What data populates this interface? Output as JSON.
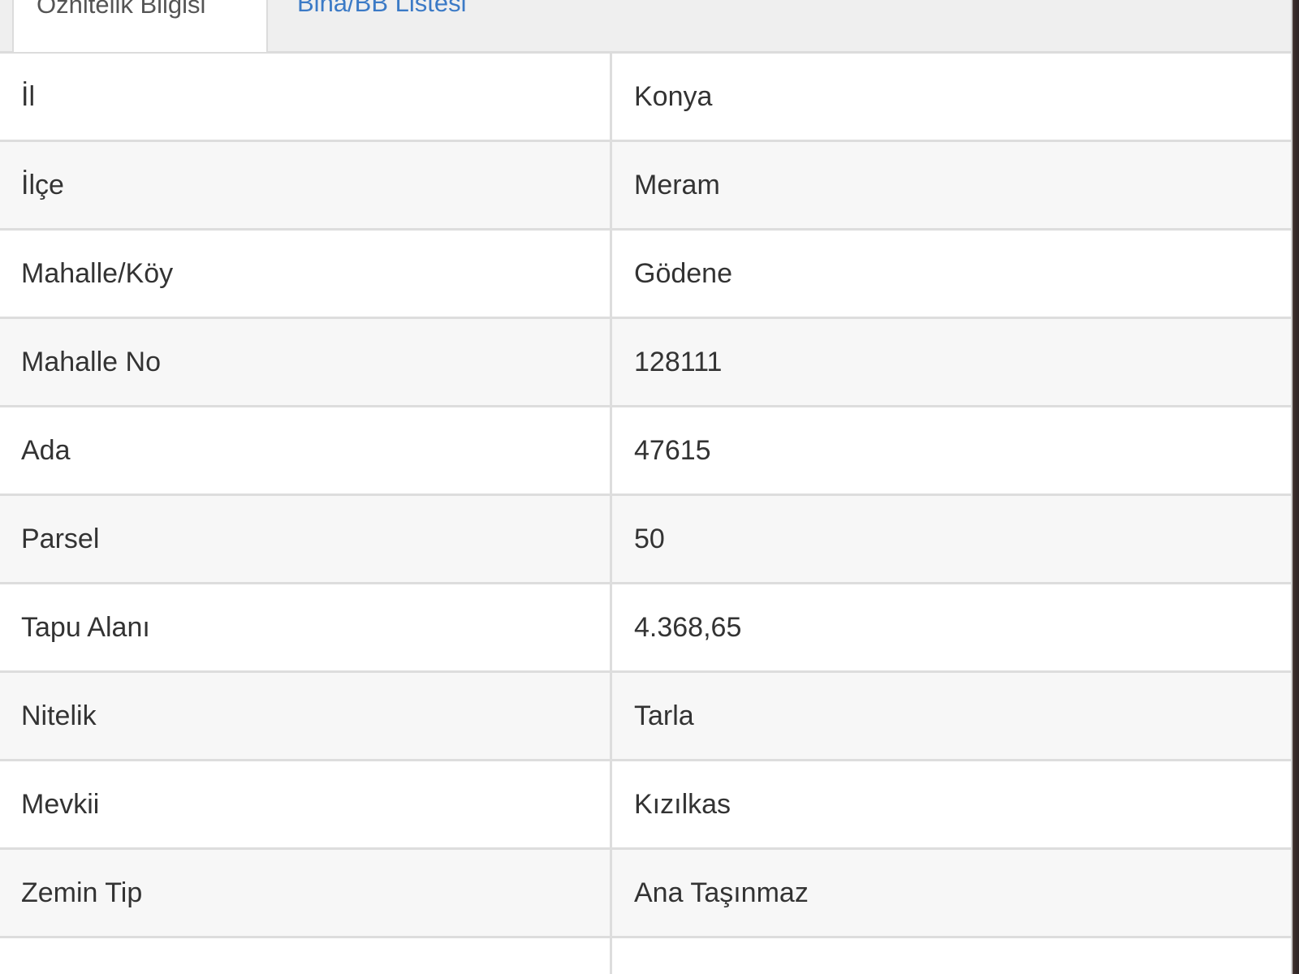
{
  "tabs": [
    {
      "label": "Öznitelik Bilgisi",
      "active": true
    },
    {
      "label": "Bina/BB Listesi",
      "active": false
    }
  ],
  "attributes": [
    {
      "label": "İl",
      "value": "Konya"
    },
    {
      "label": "İlçe",
      "value": "Meram"
    },
    {
      "label": "Mahalle/Köy",
      "value": "Gödene"
    },
    {
      "label": "Mahalle No",
      "value": "128111"
    },
    {
      "label": "Ada",
      "value": "47615"
    },
    {
      "label": "Parsel",
      "value": "50"
    },
    {
      "label": "Tapu Alanı",
      "value": "4.368,65"
    },
    {
      "label": "Nitelik",
      "value": "Tarla"
    },
    {
      "label": "Mevkii",
      "value": "Kızılkas"
    },
    {
      "label": "Zemin Tip",
      "value": "Ana Taşınmaz"
    }
  ],
  "colors": {
    "tab_link": "#3b7ac6",
    "text": "#333333",
    "border": "#dddddd",
    "stripe": "#f7f7f7"
  }
}
